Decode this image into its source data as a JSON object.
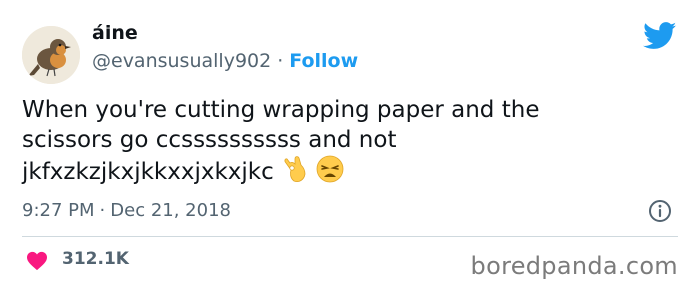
{
  "tweet": {
    "author_name": "áine",
    "handle": "@evansusually902",
    "separator": "·",
    "follow_label": "Follow",
    "text_lines": [
      "When you're cutting wrapping paper and the",
      "scissors go ccssssssssss and not",
      "jkfxzkzjkxjkkxxjxkxjkc"
    ],
    "emojis": [
      "ok-hand-emoji",
      "weary-face-emoji"
    ],
    "time": "9:27 PM",
    "date": "Dec 21, 2018",
    "like_count": "312.1K"
  },
  "watermark": "boredpanda.com",
  "colors": {
    "accent": "#1d9bf0",
    "heart": "#f91880",
    "secondary_text": "#536471"
  },
  "icons": [
    "avatar-bird-image",
    "twitter-logo-icon",
    "info-icon",
    "heart-icon"
  ]
}
